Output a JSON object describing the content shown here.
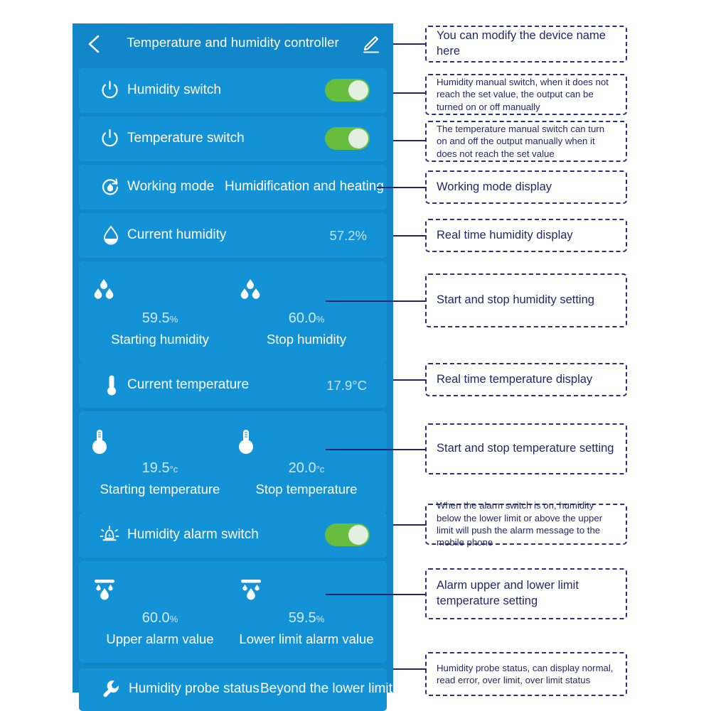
{
  "header": {
    "title": "Temperature and humidity controller",
    "back_icon": "chevron-left-icon",
    "edit_icon": "pencil-edit-icon"
  },
  "rows": {
    "humidity_switch": {
      "label": "Humidity switch",
      "icon": "power-icon",
      "toggle_state": "on"
    },
    "temperature_switch": {
      "label": "Temperature switch",
      "icon": "power-icon",
      "toggle_state": "on"
    },
    "working_mode": {
      "label": "Working mode",
      "value": "Humidification and heating",
      "icon": "mode-refresh-droplet-icon"
    },
    "current_humidity": {
      "label": "Current humidity",
      "value": "57.2%",
      "icon": "droplet-icon"
    },
    "current_temperature": {
      "label": "Current temperature",
      "value": "17.9°C",
      "icon": "thermometer-icon"
    },
    "humidity_alarm_switch": {
      "label": "Humidity alarm switch",
      "icon": "alarm-beacon-icon",
      "toggle_state": "on"
    },
    "humidity_probe_status": {
      "label": "Humidity probe status",
      "value": "Beyond the lower limit",
      "icon": "wrench-icon"
    }
  },
  "humidity_setting": {
    "start": {
      "value": "59.5",
      "unit": "%",
      "caption": "Starting humidity",
      "icon": "droplets-icon"
    },
    "stop": {
      "value": "60.0",
      "unit": "%",
      "caption": "Stop humidity",
      "icon": "droplets-icon"
    }
  },
  "temperature_setting": {
    "start": {
      "value": "19.5",
      "unit": "°c",
      "caption": "Starting temperature",
      "icon": "thermometer-bulb-icon"
    },
    "stop": {
      "value": "20.0",
      "unit": "°c",
      "caption": "Stop temperature",
      "icon": "thermometer-bulb-icon"
    }
  },
  "alarm_setting": {
    "upper": {
      "value": "60.0",
      "unit": "%",
      "caption": "Upper alarm value",
      "icon": "dripping-droplets-icon"
    },
    "lower": {
      "value": "59.5",
      "unit": "%",
      "caption": "Lower limit alarm value",
      "icon": "dripping-droplets-icon"
    }
  },
  "annotations": [
    {
      "id": "device-name",
      "text": "You can modify the device name here",
      "size": "big"
    },
    {
      "id": "humidity-switch",
      "text": "Humidity manual switch, when it does not reach the set value, the output can be turned on or off manually",
      "size": "small"
    },
    {
      "id": "temperature-switch",
      "text": "The temperature manual switch can turn on and off the output manually when it does not reach the set value",
      "size": "small"
    },
    {
      "id": "working-mode",
      "text": "Working mode display",
      "size": "big"
    },
    {
      "id": "real-time-humidity",
      "text": "Real time humidity display",
      "size": "big"
    },
    {
      "id": "humidity-setting",
      "text": "Start and stop humidity setting",
      "size": "big"
    },
    {
      "id": "real-time-temperature",
      "text": "Real time temperature display",
      "size": "big"
    },
    {
      "id": "temperature-setting",
      "text": "Start and stop temperature setting",
      "size": "big"
    },
    {
      "id": "alarm-switch",
      "text": "When the alarm switch is on, humidity below the lower limit or above the upper limit will push the alarm message to the mobile phone",
      "size": "small"
    },
    {
      "id": "alarm-limit-setting",
      "text": "Alarm upper and lower limit temperature setting",
      "size": "big"
    },
    {
      "id": "probe-status",
      "text": "Humidity probe status, can display normal, read error, over limit, over limit status",
      "size": "small"
    }
  ],
  "colors": {
    "panel_bg": "#1186c8",
    "card_bg": "#1492d6",
    "toggle_on": "#67bd3e",
    "toggle_knob": "#e3efe0",
    "annotation_border": "#2b2e7a",
    "annotation_text": "#232766",
    "value_text": "#bfe4f7"
  }
}
